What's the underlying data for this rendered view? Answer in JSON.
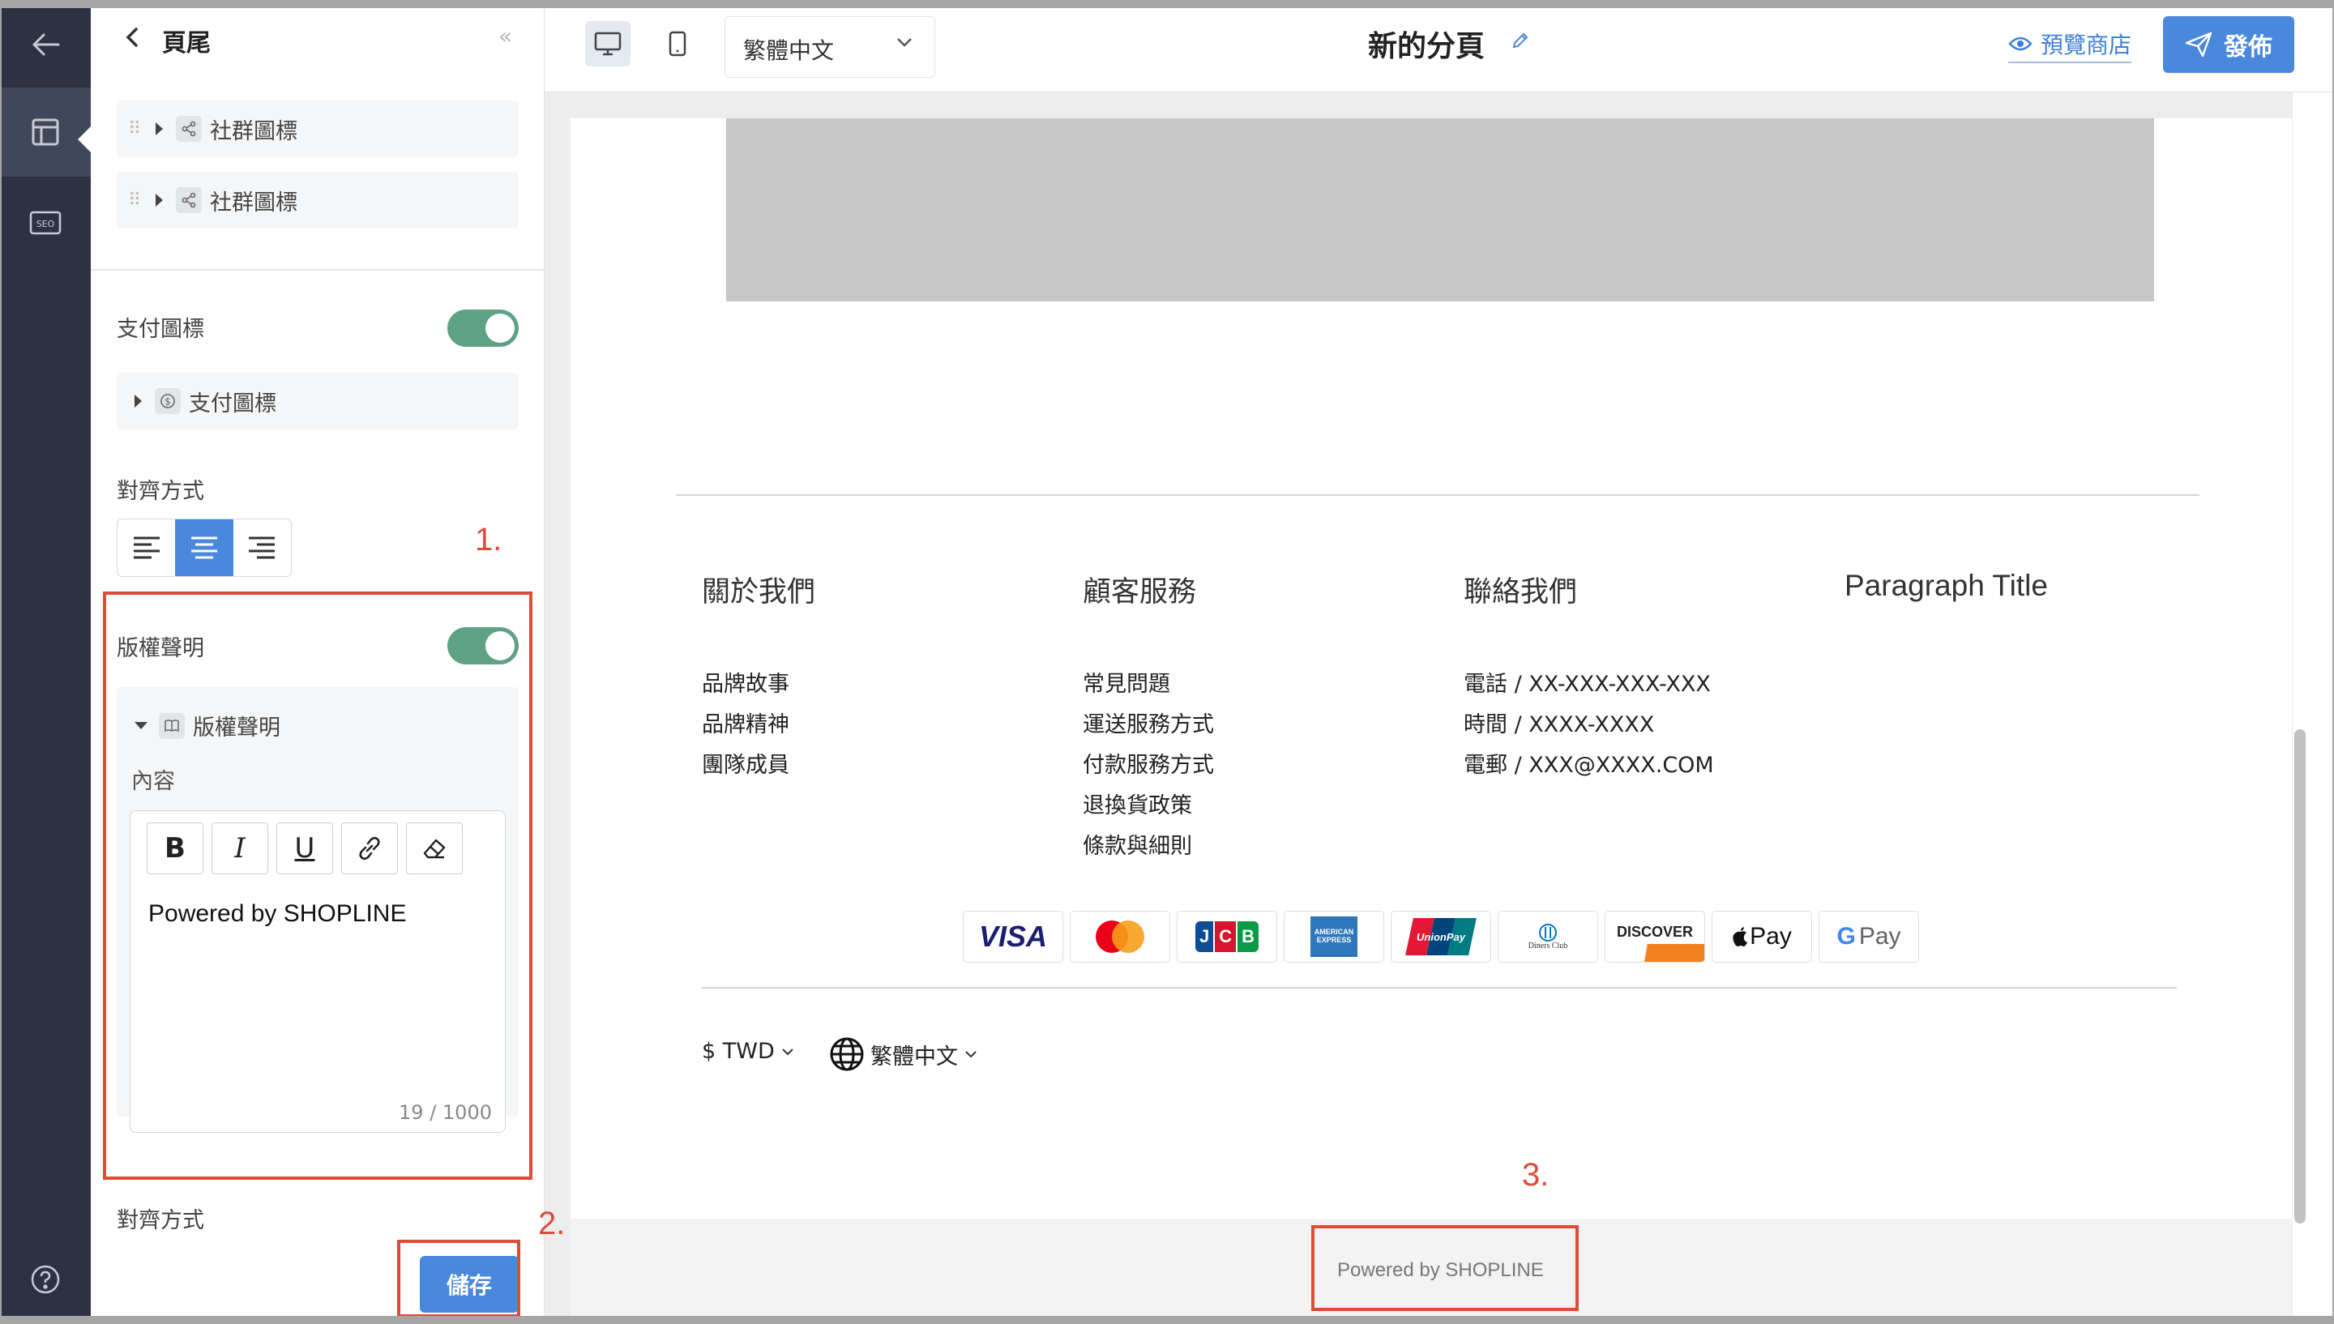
{
  "rail": {
    "items": [
      {
        "name": "back"
      },
      {
        "name": "layout",
        "active": true
      },
      {
        "name": "seo",
        "label": "SEO"
      },
      {
        "name": "help"
      }
    ]
  },
  "panel": {
    "title": "頁尾",
    "collapse_glyph": "«",
    "social_items": [
      "社群圖標",
      "社群圖標"
    ],
    "payment": {
      "label": "支付圖標",
      "enabled": true,
      "item": "支付圖標"
    },
    "alignment": {
      "label": "對齊方式",
      "options": [
        "left",
        "center",
        "right"
      ],
      "selected": "center"
    },
    "copyright": {
      "label": "版權聲明",
      "enabled": true,
      "item": "版權聲明",
      "content_label": "內容",
      "toolbar": [
        "B",
        "I",
        "U",
        "link",
        "clear-format"
      ],
      "text": "Powered by SHOPLINE",
      "count": "19 / 1000"
    },
    "alignment2_label": "對齊方式",
    "save_label": "儲存"
  },
  "topbar": {
    "language": "繁體中文",
    "page_title": "新的分頁",
    "preview_label": "預覽商店",
    "publish_label": "發佈"
  },
  "preview": {
    "columns": [
      {
        "title": "關於我們",
        "links": [
          "品牌故事",
          "品牌精神",
          "團隊成員"
        ]
      },
      {
        "title": "顧客服務",
        "links": [
          "常見問題",
          "運送服務方式",
          "付款服務方式",
          "退換貨政策",
          "條款與細則"
        ]
      },
      {
        "title": "聯絡我們",
        "links": [
          "電話 / XX-XXX-XXX-XXX",
          "時間 / XXXX-XXXX",
          "電郵 / XXX@XXXX.COM"
        ]
      },
      {
        "title": "Paragraph Title",
        "links": []
      }
    ],
    "payment_icons": [
      "VISA",
      "Mastercard",
      "JCB",
      "American Express",
      "UnionPay",
      "Diners Club",
      "DISCOVER",
      "Apple Pay",
      "G Pay"
    ],
    "payment_texts": {
      "visa": "VISA",
      "jcb": "JCB",
      "amex": "AMERICAN EXPRESS",
      "unionpay": "UnionPay",
      "diners": "Diners Club",
      "discover": "DISCOVER",
      "applepay": "Pay",
      "gpay": "Pay"
    },
    "currency": "$ TWD",
    "language": "繁體中文",
    "powered_by": "Powered by SHOPLINE"
  },
  "annotations": [
    "1.",
    "2.",
    "3."
  ],
  "colors": {
    "accent": "#4a88db",
    "toggle": "#5fa184",
    "rail": "#2d3243",
    "annotation": "#dd4b39"
  }
}
